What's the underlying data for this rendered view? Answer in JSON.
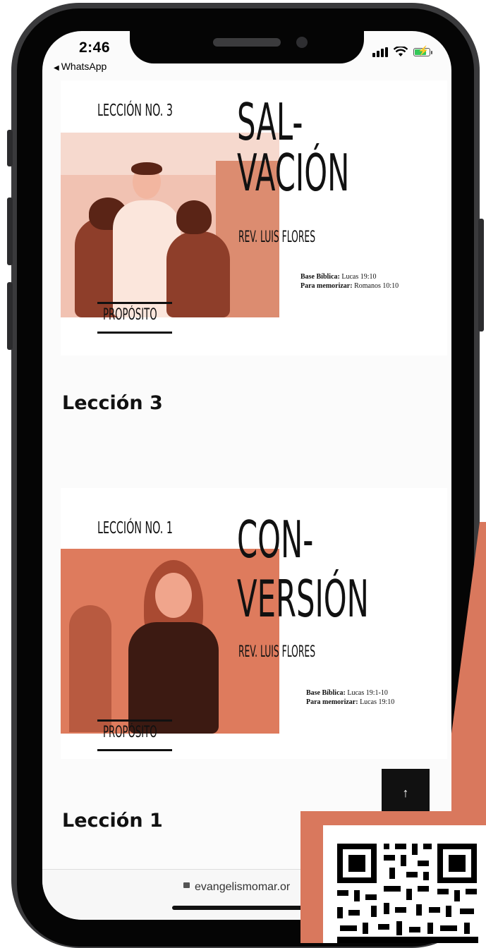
{
  "status_bar": {
    "time": "2:46",
    "back_app": "WhatsApp"
  },
  "lesson_3_card": {
    "lesson_no": "LECCIÓN NO. 3",
    "title_line1": "SAL-",
    "title_line2": "VACIÓN",
    "author": "REV. LUIS FLORES",
    "base_biblica_label": "Base Bíblica:",
    "base_biblica_value": "Lucas 19:10",
    "memorizar_label": "Para memorizar:",
    "memorizar_value": "Romanos 10:10",
    "proposito": "PROPÓSITO"
  },
  "lesson_3_heading": "Lección 3",
  "lesson_1_card": {
    "lesson_no": "LECCIÓN NO. 1",
    "title_line1": "CON-",
    "title_line2": "VERSIÓN",
    "author": "REV. LUIS FLORES",
    "base_biblica_label": "Base Bíblica:",
    "base_biblica_value": "Lucas 19:1-10",
    "memorizar_label": "Para memorizar:",
    "memorizar_value": "Lucas 19:10",
    "proposito": "PROPÓSITO"
  },
  "lesson_1_heading": "Lección 1",
  "scroll_top_icon": "↑",
  "url_bar": {
    "url": "evangelismomar.or"
  },
  "colors": {
    "accent": "#e1785b",
    "poster_red": "#d9785d",
    "text": "#111111"
  },
  "icons": [
    "back-arrow-icon",
    "signal-icon",
    "wifi-icon",
    "battery-icon",
    "lock-icon",
    "arrow-up-icon",
    "qr-code-icon"
  ]
}
